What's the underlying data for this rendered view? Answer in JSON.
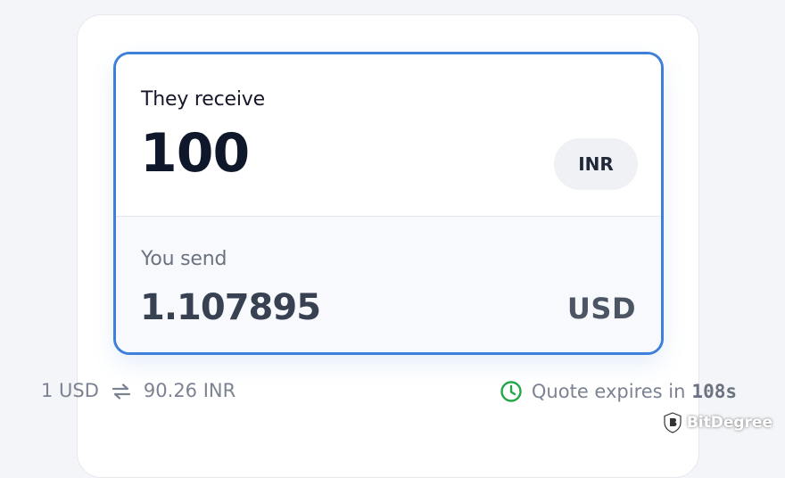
{
  "converter": {
    "receive": {
      "label": "They receive",
      "amount": "100",
      "currency": "INR"
    },
    "send": {
      "label": "You send",
      "amount": "1.107895",
      "currency": "USD"
    }
  },
  "rate": {
    "from": "1 USD",
    "to": "90.26 INR",
    "icon": "swap-arrows-icon"
  },
  "quote": {
    "text": "Quote expires in",
    "countdown": "108s",
    "icon": "clock-icon",
    "icon_color": "#22a745"
  },
  "watermark": {
    "brand": "BitDegree",
    "icon": "bitdegree-shield-logo"
  },
  "colors": {
    "accent": "#3d7fd9",
    "background": "#f4f5f8"
  }
}
